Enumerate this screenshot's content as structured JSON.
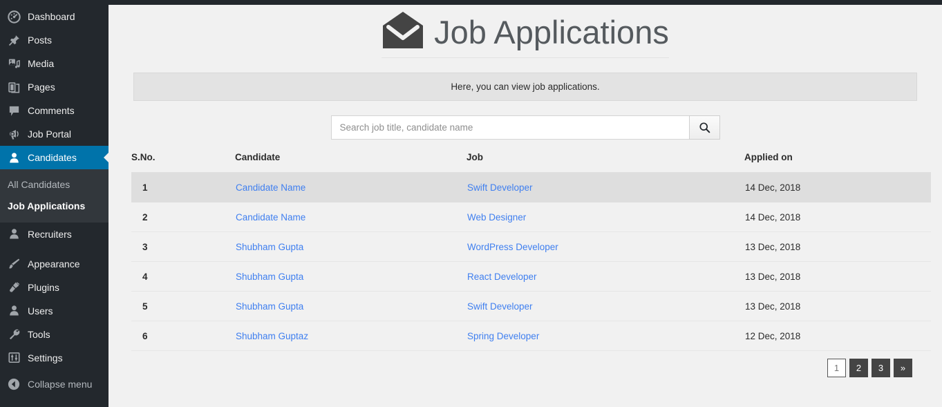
{
  "sidebar": {
    "items": [
      {
        "label": "Dashboard",
        "icon": "dashboard-icon"
      },
      {
        "label": "Posts",
        "icon": "pin-icon"
      },
      {
        "label": "Media",
        "icon": "media-icon"
      },
      {
        "label": "Pages",
        "icon": "pages-icon"
      },
      {
        "label": "Comments",
        "icon": "comments-icon"
      },
      {
        "label": "Job Portal",
        "icon": "megaphone-icon"
      },
      {
        "label": "Candidates",
        "icon": "user-icon"
      },
      {
        "label": "Recruiters",
        "icon": "user-icon"
      },
      {
        "label": "Appearance",
        "icon": "brush-icon"
      },
      {
        "label": "Plugins",
        "icon": "plug-icon"
      },
      {
        "label": "Users",
        "icon": "user-icon"
      },
      {
        "label": "Tools",
        "icon": "wrench-icon"
      },
      {
        "label": "Settings",
        "icon": "sliders-icon"
      }
    ],
    "submenu": [
      {
        "label": "All Candidates"
      },
      {
        "label": "Job Applications"
      }
    ],
    "collapse_label": "Collapse menu",
    "active_item": "Candidates",
    "active_submenu": "Job Applications",
    "accent_color": "#0073aa",
    "background_color": "#23282d",
    "submenu_background_color": "#32373c"
  },
  "header": {
    "title": "Job Applications",
    "icon": "open-envelope-icon"
  },
  "notice": {
    "text": "Here, you can view job applications."
  },
  "search": {
    "value": "",
    "placeholder": "Search job title, candidate name",
    "button_icon": "search-icon"
  },
  "table": {
    "columns": [
      "S.No.",
      "Candidate",
      "Job",
      "Applied on"
    ],
    "rows": [
      {
        "sno": "1",
        "candidate": "Candidate Name",
        "job": "Swift Developer",
        "applied_on": "14 Dec, 2018",
        "highlighted": true
      },
      {
        "sno": "2",
        "candidate": "Candidate Name",
        "job": "Web Designer",
        "applied_on": "14 Dec, 2018",
        "highlighted": false
      },
      {
        "sno": "3",
        "candidate": "Shubham Gupta",
        "job": "WordPress Developer",
        "applied_on": "13 Dec, 2018",
        "highlighted": false
      },
      {
        "sno": "4",
        "candidate": "Shubham Gupta",
        "job": "React Developer",
        "applied_on": "13 Dec, 2018",
        "highlighted": false
      },
      {
        "sno": "5",
        "candidate": "Shubham Gupta",
        "job": "Swift Developer",
        "applied_on": "13 Dec, 2018",
        "highlighted": false
      },
      {
        "sno": "6",
        "candidate": "Shubham Guptaz",
        "job": "Spring Developer",
        "applied_on": "12 Dec, 2018",
        "highlighted": false
      }
    ],
    "link_color": "#3f7ff0",
    "highlight_color": "#dedede"
  },
  "pagination": {
    "pages": [
      {
        "label": "1",
        "active": true
      },
      {
        "label": "2",
        "active": false
      },
      {
        "label": "3",
        "active": false
      },
      {
        "label": "»",
        "active": false
      }
    ]
  }
}
